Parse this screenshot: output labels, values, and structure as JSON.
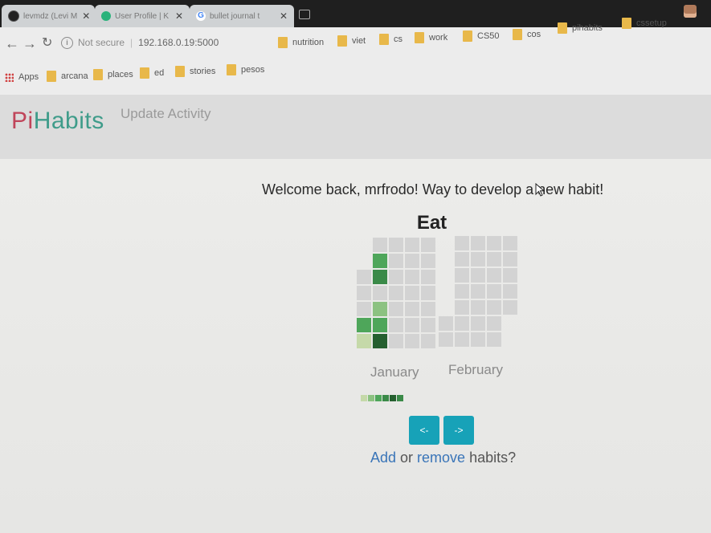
{
  "browser": {
    "tabs": [
      {
        "title": "levmdz (Levi M",
        "icon": "github-icon",
        "active": false
      },
      {
        "title": "User Profile | K",
        "icon": "globe-icon",
        "active": false
      },
      {
        "title": "bullet journal t",
        "icon": "google-icon",
        "active": false
      }
    ],
    "address": {
      "security": "Not secure",
      "url": "192.168.0.19:5000"
    },
    "bookmarks_row1": [
      "nutrition",
      "viet",
      "cs",
      "work",
      "CS50",
      "cos",
      "pihabits",
      "cssetup"
    ],
    "bookmarks_row2": [
      "Apps",
      "arcana",
      "places",
      "ed",
      "stories",
      "pesos"
    ]
  },
  "nav": {
    "brand_pi": "Pi",
    "brand_habits": "Habits",
    "update_activity": "Update Activity"
  },
  "main": {
    "welcome": "Welcome back, mrfrodo! Way to develop a new habit!",
    "habit_name": "Eat",
    "months": [
      "January",
      "February"
    ],
    "prev_label": "<-",
    "next_label": "->",
    "add_label": "Add",
    "or_label": " or ",
    "remove_label": "remove",
    "habits_suffix": " habits?"
  },
  "colors": {
    "brand_pi": "#c0455a",
    "brand_habits": "#3f9c8a",
    "button": "#17a2b8",
    "empty_cell": "#d3d3d3",
    "scale": [
      "#c5d9a9",
      "#8cc281",
      "#4ea65a",
      "#3a8a48",
      "#25602f"
    ]
  },
  "activity": {
    "january_levels": [
      [
        0,
        0,
        0,
        0,
        0
      ],
      [
        0,
        3,
        0,
        0,
        0
      ],
      [
        0,
        4,
        0,
        0,
        0
      ],
      [
        0,
        0,
        0,
        0,
        0
      ],
      [
        0,
        2,
        0,
        0,
        0
      ],
      [
        3,
        3,
        0,
        0,
        0
      ],
      [
        1,
        5,
        0,
        0,
        0
      ]
    ],
    "legend_levels": [
      1,
      2,
      3,
      4,
      5,
      4
    ]
  }
}
